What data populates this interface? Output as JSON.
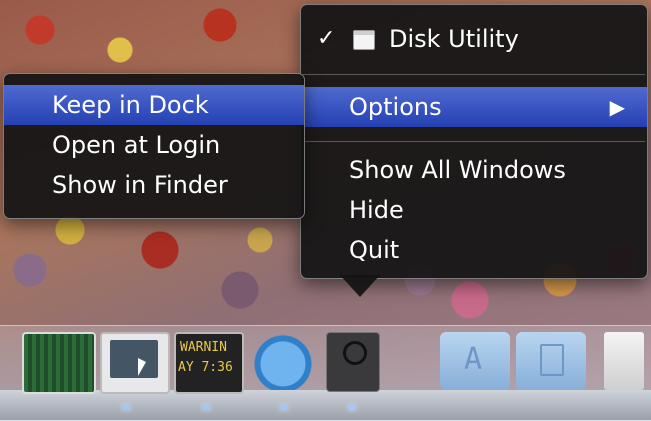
{
  "context_menu": {
    "app_name": "Disk Utility",
    "check": "✓",
    "items": [
      {
        "label": "Options",
        "submenu_arrow": "▶"
      },
      {
        "label": "Show All Windows"
      },
      {
        "label": "Hide"
      },
      {
        "label": "Quit"
      }
    ]
  },
  "options_submenu": {
    "items": [
      {
        "label": "Keep in Dock"
      },
      {
        "label": "Open at Login"
      },
      {
        "label": "Show in Finder"
      }
    ]
  },
  "dock": {
    "console_text_1": "WARNIN",
    "console_text_2": "AY 7:36"
  },
  "colors": {
    "highlight": "#3355c4",
    "menu_bg": "#141416"
  }
}
